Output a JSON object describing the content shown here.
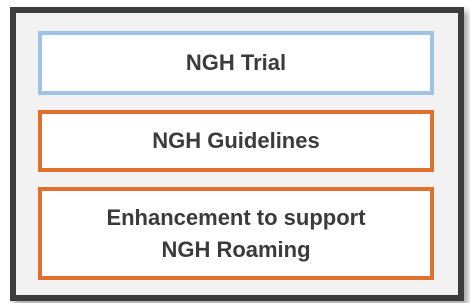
{
  "diagram": {
    "boxes": [
      {
        "lines": [
          "NGH Trial"
        ],
        "border_color": "#9dc3e6"
      },
      {
        "lines": [
          "NGH Guidelines"
        ],
        "border_color": "#e0702b"
      },
      {
        "lines": [
          "Enhancement to support",
          "NGH Roaming"
        ],
        "border_color": "#e0702b"
      }
    ],
    "frame_color": "#3d3d3d",
    "text_color": "#3b3b3b"
  }
}
